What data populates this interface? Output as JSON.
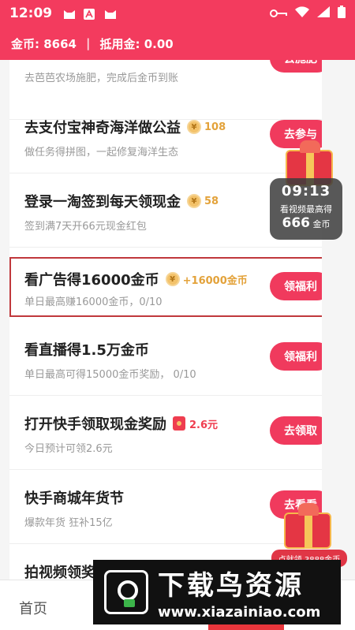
{
  "statusbar": {
    "time": "12:09"
  },
  "header": {
    "coins_label": "金币: 8664",
    "deduct_label": "抵用金: 0.00"
  },
  "tasks": [
    {
      "title": "",
      "desc": "去芭芭农场施肥，完成后金币到账",
      "button": "去施肥",
      "reward": ""
    },
    {
      "title": "去支付宝神奇海洋做公益",
      "desc": "做任务得拼图，一起修复海洋生态",
      "button": "去参与",
      "reward": "108"
    },
    {
      "title": "登录一淘签到每天领现金",
      "desc": "签到满7天开66元现金红包",
      "button": "",
      "reward": "58"
    },
    {
      "title": "看广告得16000金币",
      "desc": "单日最高赚16000金币，0/10",
      "button": "领福利",
      "reward": "+16000金币"
    },
    {
      "title": "看直播得1.5万金币",
      "desc": "单日最高可得15000金币奖励， 0/10",
      "button": "领福利",
      "reward": ""
    },
    {
      "title": "打开快手领取现金奖励",
      "desc": "今日预计可领2.6元",
      "button": "去领取",
      "reward": "2.6元"
    },
    {
      "title": "快手商城年货节",
      "desc": "爆款年货 狂补15亿",
      "button": "去看看",
      "reward": ""
    },
    {
      "title": "拍视频领奖",
      "desc": "",
      "button": "",
      "reward": ""
    }
  ],
  "timer_widget": {
    "time": "09:13",
    "line1": "看视频最高得",
    "amount": "666",
    "unit": "金币"
  },
  "float_badge": {
    "text": "点就领 3888金币"
  },
  "bottomnav": {
    "home": "首页"
  },
  "watermark": {
    "title": "下载鸟资源",
    "url": "www.xiazainiao.com"
  },
  "colors": {
    "brand": "#f33b5e",
    "button": "#f03a5d",
    "coin": "#e3a23a"
  }
}
